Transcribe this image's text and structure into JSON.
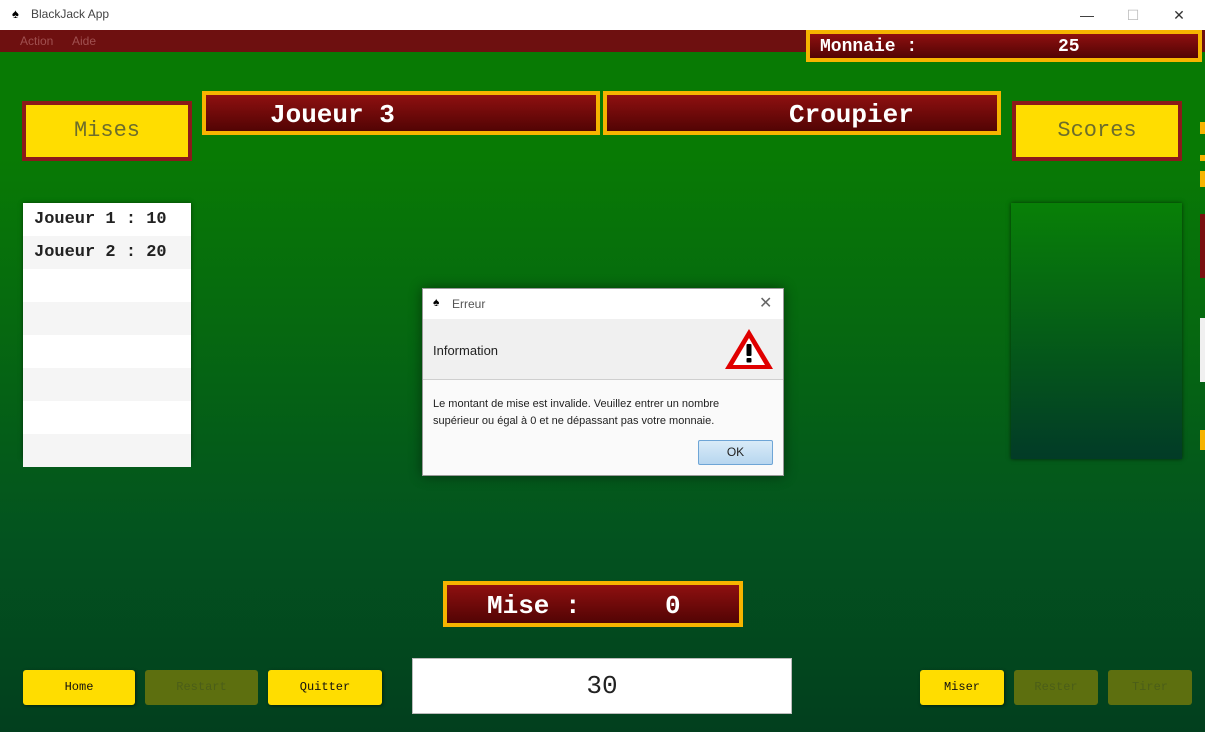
{
  "window": {
    "title": "BlackJack App",
    "icon": "spade-icon",
    "controls": [
      "—",
      "☐",
      "✕"
    ]
  },
  "menu": [
    "Action",
    "Aide"
  ],
  "money": {
    "label": "Monnaie :",
    "value": "25"
  },
  "header": {
    "player": "Joueur 3",
    "dealer": "Croupier"
  },
  "side_labels": {
    "bets": "Mises",
    "scores": "Scores"
  },
  "bets_list": [
    {
      "text": "Joueur 1 : 10"
    },
    {
      "text": "Joueur 2 : 20"
    }
  ],
  "bet_display": {
    "label": "Mise :",
    "value": "0"
  },
  "buttons": {
    "home": "Home",
    "restart": "Restart",
    "quit": "Quitter",
    "bet": "Miser",
    "stand": "Rester",
    "hit": "Tirer"
  },
  "bet_input": {
    "value": "30"
  },
  "dialog": {
    "title": "Erreur",
    "header": "Information",
    "message": "Le montant de mise est invalide. Veuillez entrer un nombre supérieur ou égal à 0 et ne dépassant pas votre monnaie.",
    "ok": "OK",
    "icon": "warning-icon"
  },
  "colors": {
    "gold": "#f6b400",
    "maroon": "#6e1010",
    "table_green": "#087a04",
    "button_yellow": "#ffdd00"
  }
}
